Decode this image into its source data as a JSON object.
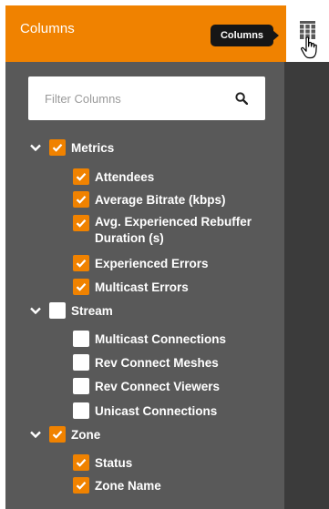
{
  "header": {
    "title": "Columns"
  },
  "tooltip": {
    "text": "Columns"
  },
  "filter": {
    "placeholder": "Filter Columns",
    "value": ""
  },
  "groups": [
    {
      "label": "Metrics",
      "checked": true,
      "expanded": true,
      "items": [
        {
          "label": "Attendees",
          "checked": true
        },
        {
          "label": "Average Bitrate (kbps)",
          "checked": true
        },
        {
          "label": "Avg. Experienced Rebuffer Duration (s)",
          "checked": true
        },
        {
          "label": "Experienced Errors",
          "checked": true
        },
        {
          "label": "Multicast Errors",
          "checked": true
        }
      ]
    },
    {
      "label": "Stream",
      "checked": false,
      "expanded": true,
      "items": [
        {
          "label": "Multicast Connections",
          "checked": false
        },
        {
          "label": "Rev Connect Meshes",
          "checked": false
        },
        {
          "label": "Rev Connect Viewers",
          "checked": false
        },
        {
          "label": "Unicast Connections",
          "checked": false
        }
      ]
    },
    {
      "label": "Zone",
      "checked": true,
      "expanded": true,
      "items": [
        {
          "label": "Status",
          "checked": true
        },
        {
          "label": "Zone Name",
          "checked": true
        }
      ]
    }
  ],
  "icons": {
    "columns": "columns-icon",
    "search": "search-icon",
    "chevron": "chevron-down-icon",
    "check": "check-icon",
    "cursor": "hand-pointer-icon"
  },
  "colors": {
    "accent": "#f08200",
    "panel": "#595959",
    "rail": "#3b3b3b",
    "tooltip": "#161616"
  }
}
